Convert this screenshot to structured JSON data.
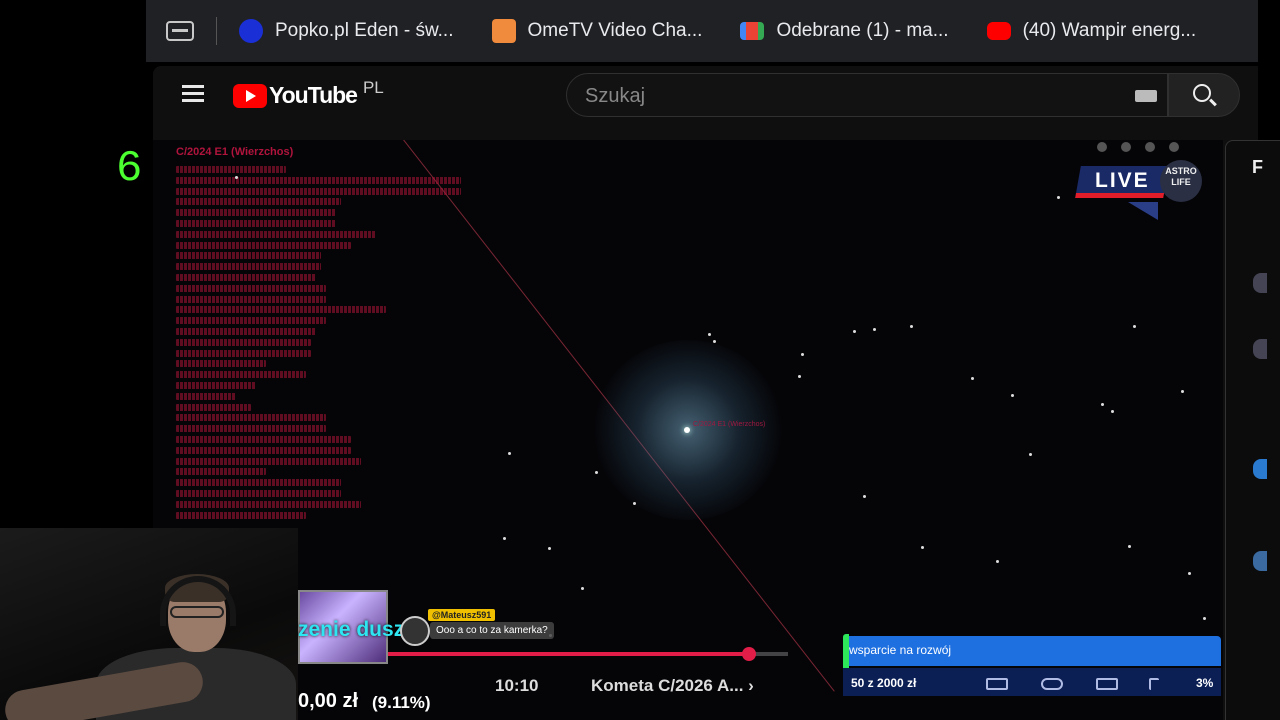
{
  "bookmarks": [
    {
      "label": "Popko.pl Eden - św...",
      "icon": "popko-icon",
      "color": "#1a2fd6"
    },
    {
      "label": "OmeTV Video Cha...",
      "icon": "ometv-icon",
      "color": "#f08a3c"
    },
    {
      "label": "Odebrane (1) - ma...",
      "icon": "gmail-icon",
      "color": "#ea4335"
    },
    {
      "label": "(40) Wampir energ...",
      "icon": "youtube-icon",
      "color": "#ff0000"
    }
  ],
  "youtube": {
    "logo_text": "YouTube",
    "country_code": "PL",
    "search_placeholder": "Szukaj"
  },
  "video": {
    "info_title": "C/2024 E1 (Wierzchos)",
    "star_label": "C/2024 E1 (Wierzchos)",
    "live_label": "LIVE",
    "brand_label": "ASTRO LIFE",
    "time": "10:10",
    "title": "Kometa C/2026 A... ›",
    "progress": 0.92
  },
  "right_panel": {
    "letter": "F"
  },
  "overlay": {
    "counter": "6",
    "alert_text": "zenie duszy",
    "chat_name": "@Mateusz591",
    "chat_message": "Ooo a co to za kamerka?",
    "donation_amount": "0,00 zł",
    "donation_pct": "(9.11%)"
  },
  "goal": {
    "title": "wsparcie na rozwój",
    "amount": "50 z 2000 zł",
    "percent": "3%",
    "colors": {
      "bar": "#1e6fe0",
      "accent": "#2ee65a"
    }
  }
}
